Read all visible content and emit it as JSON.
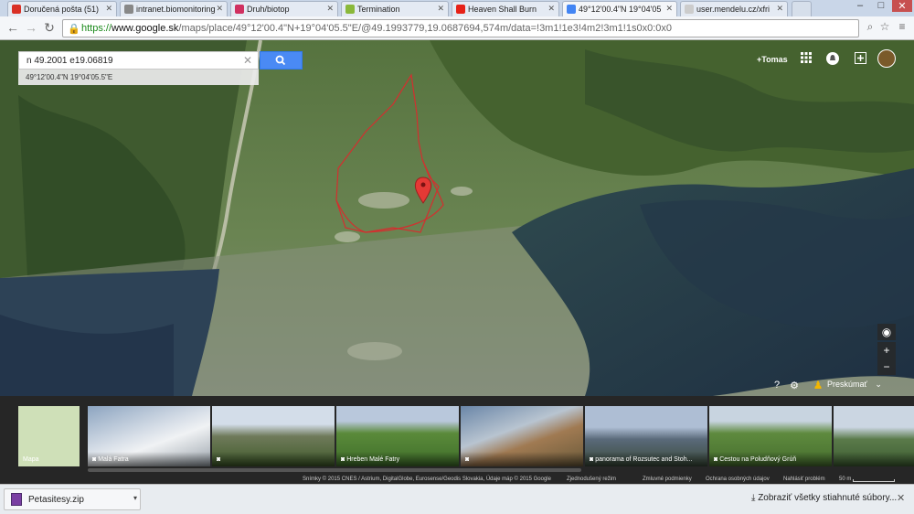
{
  "browser": {
    "tabs": [
      {
        "label": "Doručená pošta (51)",
        "color": "#d93025"
      },
      {
        "label": "intranet.biomonitoring",
        "color": "#888888"
      },
      {
        "label": "Druh/biotop",
        "color": "#d03060"
      },
      {
        "label": "Termination",
        "color": "#8ab83a"
      },
      {
        "label": "Heaven Shall Burn",
        "color": "#e62117"
      },
      {
        "label": "49°12'00.4\"N 19°04'05",
        "color": "#4285f4"
      },
      {
        "label": "user.mendelu.cz/xfri",
        "color": "#cccccc"
      }
    ],
    "url_scheme": "https://",
    "url_host": "www.google.sk",
    "url_path": "/maps/place/49°12'00.4\"N+19°04'05.5\"E/@49.1993779,19.0687694,574m/data=!3m1!1e3!4m2!3m1!1s0x0:0x0"
  },
  "map": {
    "search_value": "n 49.2001 e19.06819",
    "suggestion": "49°12'00.4\"N 19°04'05.5\"E",
    "user_name": "+Tomas",
    "explore_label": "Preskúmať",
    "pin_color": "#e53935",
    "outline_color": "#d32f2f"
  },
  "filmstrip": {
    "items": [
      {
        "caption": "Mapa"
      },
      {
        "caption": "Malá Fatra"
      },
      {
        "caption": ""
      },
      {
        "caption": "Hreben Malé Fatry"
      },
      {
        "caption": ""
      },
      {
        "caption": "panorama of Rozsutec and Stoh..."
      },
      {
        "caption": "Cestou na Poludňový Grúň"
      },
      {
        "caption": ""
      }
    ]
  },
  "footer": {
    "imagery": "Snímky © 2015 CNES / Astrium, DigitalGlobe, Eurosense/Geodis Slovakia, Údaje máp © 2015 Google",
    "simplified": "Zjednodušený režim",
    "terms": "Zmluvné podmienky",
    "privacy": "Ochrana osobných údajov",
    "report": "Nahlásiť problém",
    "scale": "50 m"
  },
  "downloads": {
    "file": "Petasitesy.zip",
    "show_all": "Zobraziť všetky stiahnuté súbory..."
  }
}
